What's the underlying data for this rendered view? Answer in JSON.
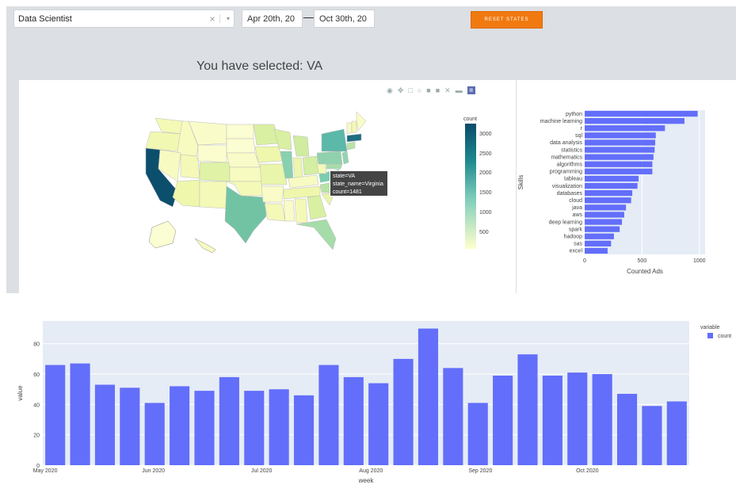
{
  "filters": {
    "job_title": "Data Scientist",
    "clear_icon": "×",
    "caret_icon": "▾",
    "date_start": "Apr 20th, 20",
    "date_arrow": "⟶",
    "date_end": "Oct 30th, 20",
    "reset_label": "RESET STATES"
  },
  "selected_text": "You have selected: VA",
  "map": {
    "colorbar_title": "count",
    "colorbar_ticks": [
      "3000",
      "2500",
      "2000",
      "1500",
      "1000",
      "500"
    ],
    "tooltip": {
      "line1": "state=VA",
      "line2": "state_name=Virginia",
      "line3": "count=1481"
    },
    "colors": {
      "low": "#ffffcc",
      "mid": "#7fcdbb",
      "high": "#0a4c6a"
    }
  },
  "chart_data": [
    {
      "type": "bar",
      "orientation": "horizontal",
      "categories": [
        "python",
        "machine learning",
        "r",
        "sql",
        "data analysis",
        "statistics",
        "mathematics",
        "algorithms",
        "programming",
        "tableau",
        "visualization",
        "databases",
        "cloud",
        "java",
        "aws",
        "deep learning",
        "spark",
        "hadoop",
        "sas",
        "excel"
      ],
      "values": [
        985,
        870,
        700,
        620,
        615,
        610,
        600,
        590,
        590,
        470,
        460,
        415,
        405,
        360,
        345,
        325,
        305,
        255,
        230,
        200
      ],
      "xlabel": "Counted Ads",
      "ylabel": "Skills",
      "xlim": [
        0,
        1050
      ],
      "xticks": [
        "0",
        "500",
        "1000"
      ],
      "color": "#636efa"
    },
    {
      "type": "bar",
      "x": [
        "May 2020",
        "Jun 2020",
        "Jul 2020",
        "Aug 2020",
        "Sep 2020",
        "Oct 2020"
      ],
      "values": [
        66,
        67,
        53,
        51,
        41,
        52,
        49,
        58,
        49,
        50,
        46,
        66,
        58,
        54,
        70,
        90,
        64,
        41,
        59,
        73,
        59,
        61,
        60,
        47,
        39,
        42
      ],
      "xlabel": "week",
      "ylabel": "value",
      "ylim": [
        0,
        95
      ],
      "yticks": [
        "0",
        "20",
        "40",
        "60",
        "80"
      ],
      "legend_title": "variable",
      "legend_entry": "count",
      "color": "#636efa"
    }
  ]
}
